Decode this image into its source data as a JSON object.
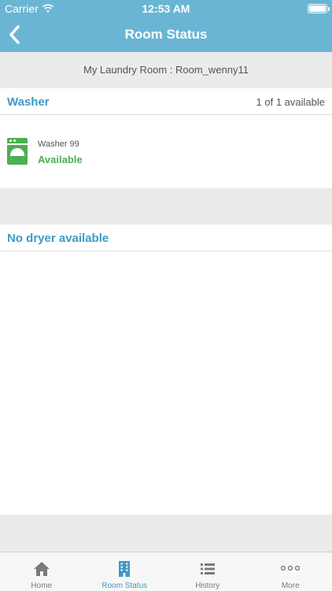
{
  "status_bar": {
    "carrier": "Carrier",
    "time": "12:53 AM",
    "battery_level": 1.0
  },
  "nav": {
    "title": "Room Status",
    "back_icon": "chevron-left-icon"
  },
  "room": {
    "label": "My Laundry Room : Room_wenny11"
  },
  "washer_section": {
    "title": "Washer",
    "count": "1 of 1 available",
    "machines": [
      {
        "name": "Washer 99",
        "status": "Available",
        "icon": "washer-icon"
      }
    ]
  },
  "dryer_section": {
    "title": "No dryer available"
  },
  "tabs": [
    {
      "label": "Home",
      "icon": "home-icon",
      "active": false
    },
    {
      "label": "Room Status",
      "icon": "building-icon",
      "active": true
    },
    {
      "label": "History",
      "icon": "list-icon",
      "active": false
    },
    {
      "label": "More",
      "icon": "more-icon",
      "active": false
    }
  ],
  "colors": {
    "header": "#6bb5d4",
    "accent": "#3e9ac5",
    "available": "#4caf50",
    "inactive": "#7a7a7a"
  }
}
